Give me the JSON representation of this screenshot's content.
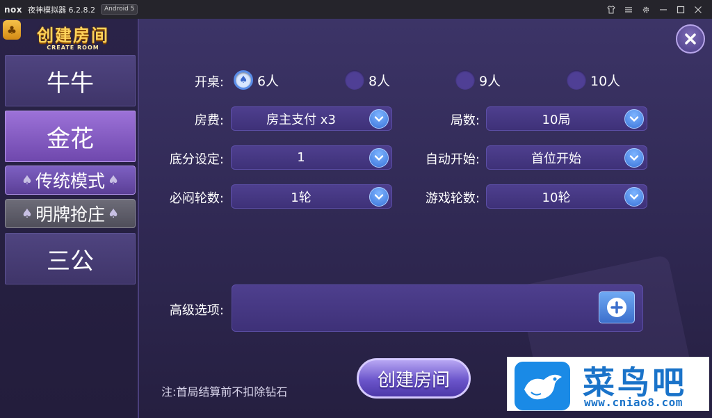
{
  "titlebar": {
    "logo": "nox",
    "title": "夜神模拟器 6.2.8.2",
    "android_badge": "Android 5",
    "controls": [
      "shirt-icon",
      "menu-icon",
      "gear-icon",
      "minimize-icon",
      "maximize-icon",
      "close-icon"
    ]
  },
  "brand": {
    "title_cn": "创建房间",
    "title_en": "CREATE ROOM",
    "tab_icon": "club-icon"
  },
  "sidebar": {
    "items": [
      {
        "label": "牛牛",
        "active": false
      },
      {
        "label": "金花",
        "active": true
      },
      {
        "label": "传统模式",
        "active": true,
        "sub": true
      },
      {
        "label": "明牌抢庄",
        "active": false,
        "sub": true
      },
      {
        "label": "三公",
        "active": false
      }
    ]
  },
  "form": {
    "table_size": {
      "label": "开桌:",
      "options": [
        "6人",
        "8人",
        "9人",
        "10人"
      ],
      "selected": "6人"
    },
    "room_fee": {
      "label": "房费:",
      "value": "房主支付 x3"
    },
    "rounds": {
      "label": "局数:",
      "value": "10局"
    },
    "base_score": {
      "label": "底分设定:",
      "value": "1"
    },
    "auto_start": {
      "label": "自动开始:",
      "value": "首位开始"
    },
    "must_stuff": {
      "label": "必闷轮数:",
      "value": "1轮"
    },
    "game_rounds": {
      "label": "游戏轮数:",
      "value": "10轮"
    },
    "advanced": {
      "label": "高级选项:"
    }
  },
  "footer": {
    "note": "注:首局结算前不扣除钻石",
    "create_button": "创建房间"
  },
  "watermark": {
    "text_cn": "菜鸟吧",
    "url": "www.cniao8.com"
  },
  "colors": {
    "panel_bg": "#3c3467",
    "select_bg": "#4e3f8e",
    "accent_blue": "#3b74d9",
    "gold": "#ffd25a"
  }
}
